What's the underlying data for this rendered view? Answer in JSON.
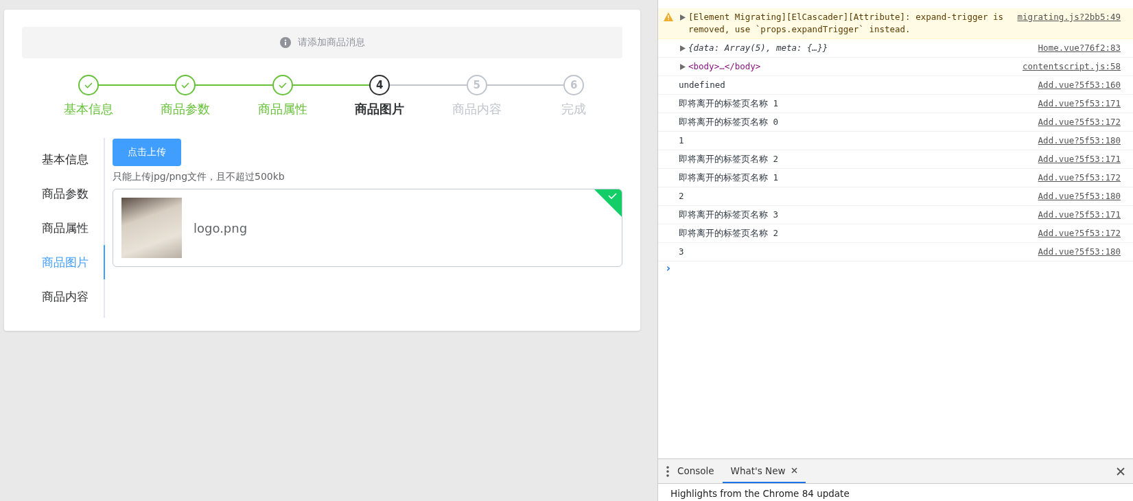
{
  "alert": {
    "text": "请添加商品消息"
  },
  "steps": [
    {
      "label": "基本信息",
      "finished": true,
      "current": false
    },
    {
      "label": "商品参数",
      "finished": true,
      "current": false
    },
    {
      "label": "商品属性",
      "finished": true,
      "current": false
    },
    {
      "label": "商品图片",
      "number": "4",
      "finished": false,
      "current": true
    },
    {
      "label": "商品内容",
      "number": "5",
      "finished": false,
      "current": false
    },
    {
      "label": "完成",
      "number": "6",
      "finished": false,
      "current": false
    }
  ],
  "side_tabs": [
    {
      "label": "基本信息",
      "selected": false
    },
    {
      "label": "商品参数",
      "selected": false
    },
    {
      "label": "商品属性",
      "selected": false
    },
    {
      "label": "商品图片",
      "selected": true
    },
    {
      "label": "商品内容",
      "selected": false
    }
  ],
  "upload": {
    "button": "点击上传",
    "hint": "只能上传jpg/png文件，且不超过500kb",
    "files": [
      {
        "name": "logo.png",
        "uploaded": true
      }
    ]
  },
  "console": {
    "rows": [
      {
        "kind": "warning",
        "text": "[Element Migrating][ElCascader][Attribute]: expand-trigger is removed, use `props.expandTrigger` instead.",
        "source": "migrating.js?2bb5:49"
      },
      {
        "kind": "object",
        "text": "{data: Array(5), meta: {…}}",
        "source": "Home.vue?76f2:83"
      },
      {
        "kind": "element",
        "text": "<body>…</body>",
        "source": "contentscript.js:58"
      },
      {
        "kind": "log",
        "text": "undefined",
        "source": "Add.vue?5f53:160"
      },
      {
        "kind": "log",
        "text": "即将离开的标签页名称 1",
        "source": "Add.vue?5f53:171"
      },
      {
        "kind": "log",
        "text": "即将离开的标签页名称 0",
        "source": "Add.vue?5f53:172"
      },
      {
        "kind": "log",
        "text": "1",
        "source": "Add.vue?5f53:180"
      },
      {
        "kind": "log",
        "text": "即将离开的标签页名称 2",
        "source": "Add.vue?5f53:171"
      },
      {
        "kind": "log",
        "text": "即将离开的标签页名称 1",
        "source": "Add.vue?5f53:172"
      },
      {
        "kind": "log",
        "text": "2",
        "source": "Add.vue?5f53:180"
      },
      {
        "kind": "log",
        "text": "即将离开的标签页名称 3",
        "source": "Add.vue?5f53:171"
      },
      {
        "kind": "log",
        "text": "即将离开的标签页名称 2",
        "source": "Add.vue?5f53:172"
      },
      {
        "kind": "log",
        "text": "3",
        "source": "Add.vue?5f53:180"
      }
    ],
    "prompt": "›"
  },
  "drawer": {
    "tabs": [
      {
        "label": "Console",
        "selected": false,
        "closable": false
      },
      {
        "label": "What's New",
        "selected": true,
        "closable": true
      }
    ],
    "content": "Highlights from the Chrome 84 update"
  }
}
